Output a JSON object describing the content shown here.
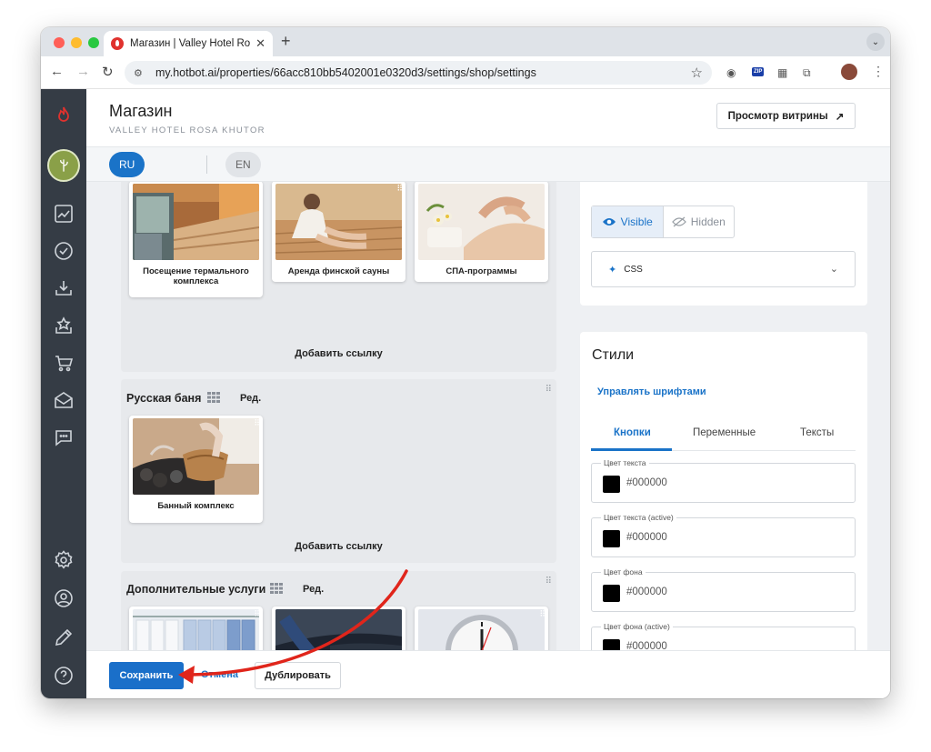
{
  "browser": {
    "tab_title": "Магазин | Valley Hotel Rosa K",
    "tab_close": "✕",
    "new_tab": "+",
    "tab_menu": "⌄",
    "url": "my.hotbot.ai/properties/66acc810bb5402001e0320d3/settings/shop/settings",
    "ext_zip_label": "ZIP"
  },
  "header": {
    "title": "Магазин",
    "subtitle": "VALLEY HOTEL ROSA KHUTOR",
    "preview_button": "Просмотр витрины",
    "preview_icon": "↗"
  },
  "languages": {
    "active": "RU",
    "inactive": "EN"
  },
  "sections": [
    {
      "title": "",
      "cards": [
        {
          "caption": "Посещение термального комплекса"
        },
        {
          "caption": "Аренда финской сауны"
        },
        {
          "caption": "СПА-программы"
        }
      ],
      "add_link": "Добавить ссылку"
    },
    {
      "title": "Русская баня",
      "edit": "Ред.",
      "cards": [
        {
          "caption": "Банный комплекс"
        }
      ],
      "add_link": "Добавить ссылку"
    },
    {
      "title": "Дополнительные услуги",
      "edit": "Ред.",
      "cards": [
        {
          "caption": ""
        },
        {
          "caption": ""
        },
        {
          "caption": ""
        }
      ]
    }
  ],
  "visibility": {
    "visible": "Visible",
    "hidden": "Hidden",
    "css_label": "CSS"
  },
  "styles": {
    "title": "Стили",
    "fonts_link": "Управлять шрифтами",
    "tabs": [
      "Кнопки",
      "Переменные",
      "Тексты"
    ],
    "fields": [
      {
        "label": "Цвет текста",
        "value": "#000000"
      },
      {
        "label": "Цвет текста (active)",
        "value": "#000000"
      },
      {
        "label": "Цвет фона",
        "value": "#000000"
      },
      {
        "label": "Цвет фона (active)",
        "value": "#000000"
      }
    ]
  },
  "footer": {
    "save": "Сохранить",
    "cancel": "Отмена",
    "duplicate": "Дублировать"
  },
  "colors": {
    "accent": "#1a73c8",
    "sidebar": "#353c45",
    "brand_flame": "#e0322e",
    "annotation_arrow": "#e0251b"
  }
}
